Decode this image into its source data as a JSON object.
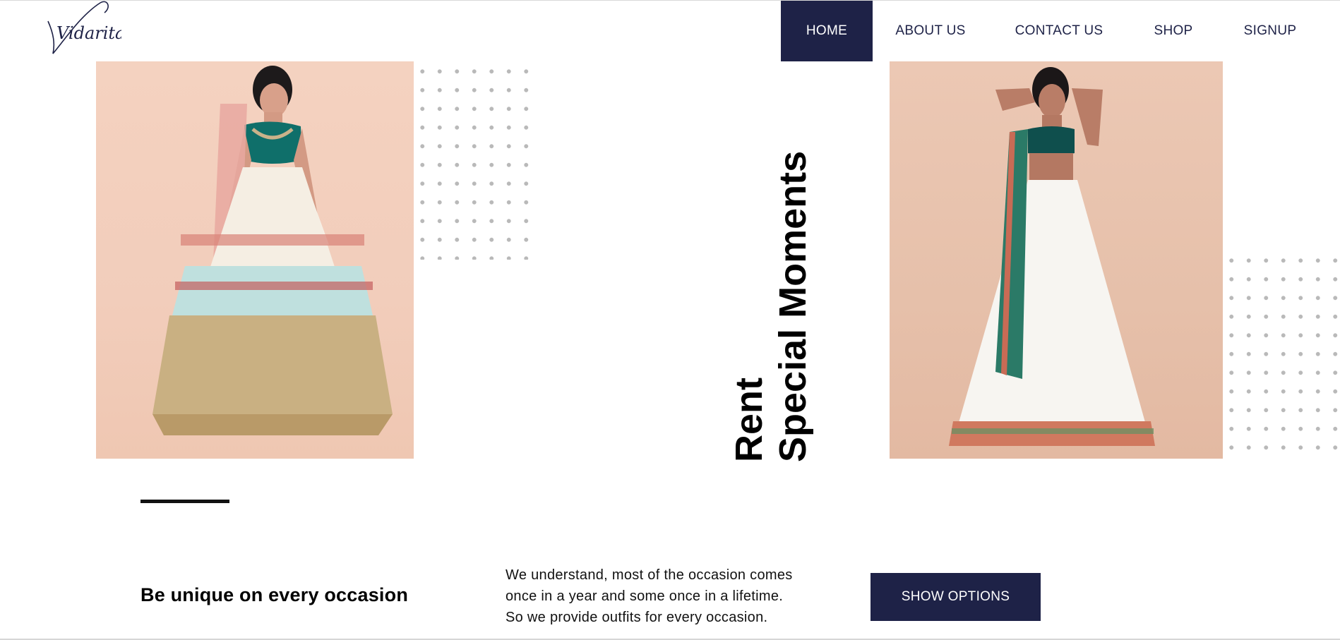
{
  "brand": {
    "logo_text": "Vidarita",
    "color": "#1e2247"
  },
  "nav": {
    "items": [
      {
        "label": "HOME",
        "active": true
      },
      {
        "label": "ABOUT US",
        "active": false
      },
      {
        "label": "CONTACT US",
        "active": false
      },
      {
        "label": "SHOP",
        "active": false
      },
      {
        "label": "SIGNUP",
        "active": false
      }
    ]
  },
  "hero": {
    "headline_line1": "Rent",
    "headline_line2": "Special Moments",
    "images": [
      {
        "name": "model-in-pastel-lehenga"
      },
      {
        "name": "model-in-white-lehenga-green-dupatta"
      }
    ]
  },
  "intro": {
    "tagline": "Be unique on every occasion",
    "paragraph_lines": [
      "We understand, most of the occasion comes",
      "once in a year and some once in a lifetime.",
      "So we provide outfits for every occasion."
    ],
    "cta_label": "SHOW OPTIONS"
  },
  "colors": {
    "accent": "#1e2247",
    "text": "#000000",
    "background": "#ffffff"
  }
}
